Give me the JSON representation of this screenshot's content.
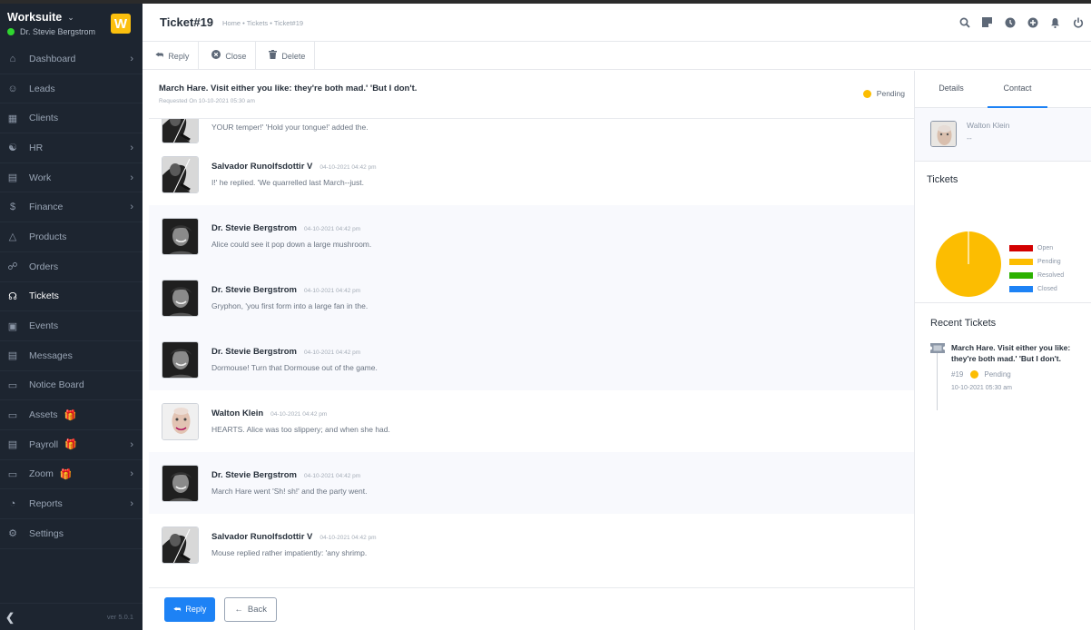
{
  "app": {
    "brand": "Worksuite",
    "user": "Dr. Stevie Bergstrom",
    "logo_letter": "W",
    "version": "ver 5.0.1",
    "colors": {
      "accent": "#1d82f5",
      "sidebar": "#1d2530",
      "pending": "#fcbd01",
      "online": "#2fd52f",
      "logo": "#fcc00e"
    }
  },
  "sidebar": {
    "items": [
      {
        "label": "Dashboard",
        "icon": "home-icon",
        "arrow": true
      },
      {
        "label": "Leads",
        "icon": "user-icon",
        "arrow": false
      },
      {
        "label": "Clients",
        "icon": "building-icon",
        "arrow": false
      },
      {
        "label": "HR",
        "icon": "people-icon",
        "arrow": true
      },
      {
        "label": "Work",
        "icon": "briefcase-icon",
        "arrow": true
      },
      {
        "label": "Finance",
        "icon": "dollar-icon",
        "arrow": true
      },
      {
        "label": "Products",
        "icon": "basket-icon",
        "arrow": false
      },
      {
        "label": "Orders",
        "icon": "cart-icon",
        "arrow": false
      },
      {
        "label": "Tickets",
        "icon": "headset-icon",
        "arrow": false,
        "active": true
      },
      {
        "label": "Events",
        "icon": "calendar-icon",
        "arrow": false
      },
      {
        "label": "Messages",
        "icon": "chat-icon",
        "arrow": false
      },
      {
        "label": "Notice Board",
        "icon": "clipboard-icon",
        "arrow": false
      },
      {
        "label": "Assets",
        "icon": "monitor-icon",
        "arrow": false,
        "gift": true
      },
      {
        "label": "Payroll",
        "icon": "wallet-icon",
        "arrow": true,
        "gift": true
      },
      {
        "label": "Zoom",
        "icon": "video-icon",
        "arrow": true,
        "gift": true
      },
      {
        "label": "Reports",
        "icon": "pie-chart-icon",
        "arrow": true
      },
      {
        "label": "Settings",
        "icon": "gear-icon",
        "arrow": false
      }
    ]
  },
  "header": {
    "title": "Ticket#19",
    "breadcrumb": "Home • Tickets • Ticket#19",
    "icons": [
      "search-icon",
      "sticky-note-icon",
      "clock-icon",
      "plus-circle-icon",
      "bell-icon",
      "power-icon"
    ]
  },
  "actions": {
    "reply": "Reply",
    "close": "Close",
    "delete": "Delete"
  },
  "ticket": {
    "subject": "March Hare. Visit either you like: they're both mad.' 'But I don't.",
    "requested": "Requested On 10-10-2021 05:30 am",
    "status": "Pending"
  },
  "messages": [
    {
      "name": "",
      "time": "",
      "text": "YOUR temper!' 'Hold your tongue!' added the.",
      "avatar": "violin"
    },
    {
      "name": "Salvador Runolfsdottir V",
      "time": "04-10-2021 04:42 pm",
      "text": "I!' he replied. 'We quarrelled last March--just.",
      "avatar": "violin"
    },
    {
      "name": "Dr. Stevie Bergstrom",
      "time": "04-10-2021 04:42 pm",
      "text": "Alice could see it pop down a large mushroom.",
      "avatar": "smile"
    },
    {
      "name": "Dr. Stevie Bergstrom",
      "time": "04-10-2021 04:42 pm",
      "text": "Gryphon, 'you first form into a large fan in the.",
      "avatar": "smile"
    },
    {
      "name": "Dr. Stevie Bergstrom",
      "time": "04-10-2021 04:42 pm",
      "text": "Dormouse! Turn that Dormouse out of the game.",
      "avatar": "smile"
    },
    {
      "name": "Walton Klein",
      "time": "04-10-2021 04:42 pm",
      "text": "HEARTS. Alice was too slippery; and when she had.",
      "avatar": "bald"
    },
    {
      "name": "Dr. Stevie Bergstrom",
      "time": "04-10-2021 04:42 pm",
      "text": "March Hare went 'Sh! sh!' and the party went.",
      "avatar": "smile"
    },
    {
      "name": "Salvador Runolfsdottir V",
      "time": "04-10-2021 04:42 pm",
      "text": "Mouse replied rather impatiently: 'any shrimp.",
      "avatar": "violin"
    }
  ],
  "footer": {
    "reply": "Reply",
    "back": "Back"
  },
  "right": {
    "tabs": [
      "Details",
      "Contact"
    ],
    "active_tab": "Contact",
    "contact": {
      "name": "Walton Klein",
      "sub": "--"
    },
    "tickets_title": "Tickets",
    "recent_title": "Recent Tickets",
    "recent": [
      {
        "title": "March Hare. Visit either you like: they're both mad.' 'But I don't.",
        "id": "#19",
        "status": "Pending",
        "date": "10-10-2021 05:30 am"
      }
    ]
  },
  "chart_data": {
    "type": "pie",
    "title": "Tickets",
    "categories": [
      "Open",
      "Pending",
      "Resolved",
      "Closed"
    ],
    "values": [
      0,
      1,
      0,
      0
    ],
    "colors": [
      "#d30000",
      "#fcbd01",
      "#2cb100",
      "#1d82f5"
    ],
    "legend": "right"
  }
}
